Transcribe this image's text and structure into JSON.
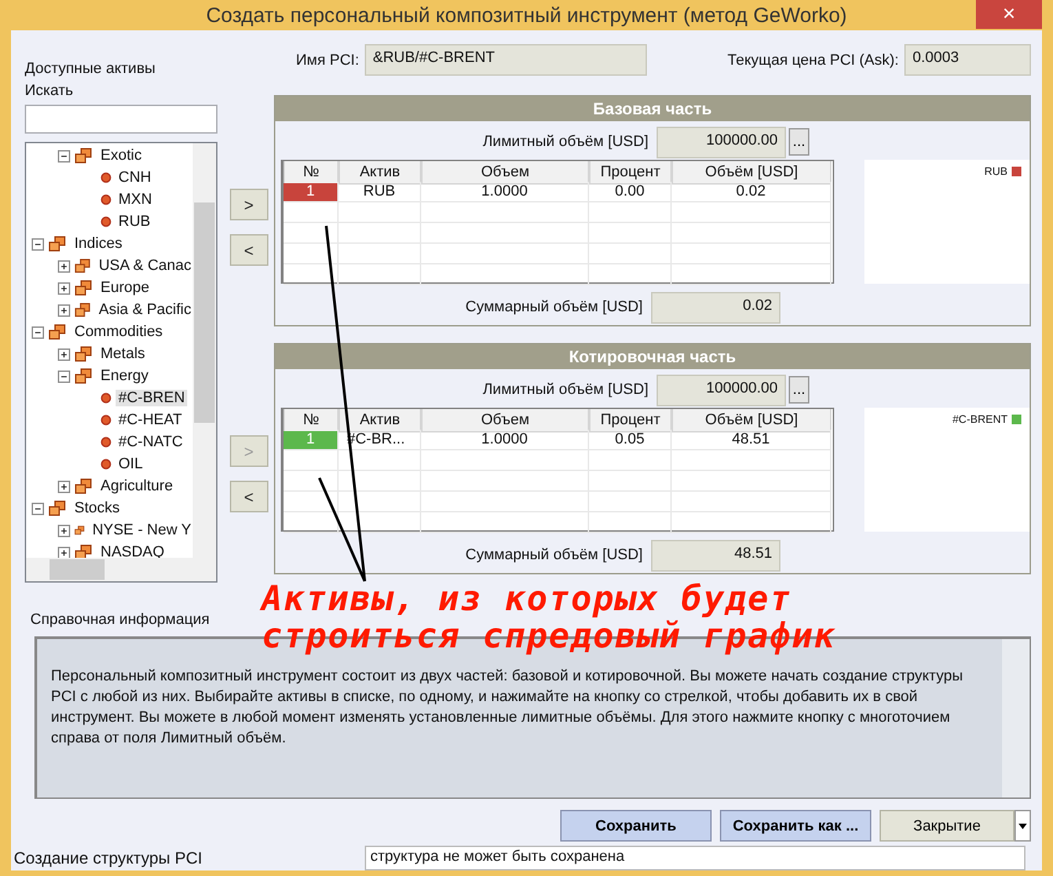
{
  "window": {
    "title": "Создать персональный композитный инструмент (метод GeWorko)",
    "close": "×"
  },
  "assets": {
    "label": "Доступные активы",
    "search_label": "Искать",
    "tree_continued": [
      {
        "label": "Exotic",
        "expanded": true,
        "selected": false,
        "children": [
          {
            "label": "CNH",
            "selected": false
          },
          {
            "label": "MXN",
            "selected": false
          },
          {
            "label": "RUB",
            "selected": false
          }
        ]
      }
    ],
    "tree": [
      {
        "label": "Indices",
        "expanded": true,
        "selected": false,
        "children": [
          {
            "label": "USA & Canac",
            "expanded": false,
            "selected": false
          },
          {
            "label": "Europe",
            "expanded": false,
            "selected": false
          },
          {
            "label": "Asia & Pacific",
            "expanded": false,
            "selected": false
          }
        ]
      },
      {
        "label": "Commodities",
        "expanded": true,
        "selected": false,
        "children": [
          {
            "label": "Metals",
            "expanded": false,
            "selected": false
          },
          {
            "label": "Energy",
            "expanded": true,
            "selected": false,
            "children": [
              {
                "label": "#C-BREN",
                "selected": true
              },
              {
                "label": "#C-HEAT",
                "selected": false
              },
              {
                "label": "#C-NATC",
                "selected": false
              },
              {
                "label": "OIL",
                "selected": false
              }
            ]
          },
          {
            "label": "Agriculture",
            "expanded": false,
            "selected": false
          }
        ]
      },
      {
        "label": "Stocks",
        "expanded": true,
        "selected": false,
        "children": [
          {
            "label": "NYSE - New Y",
            "expanded": false,
            "selected": false
          },
          {
            "label": "NASDAQ",
            "expanded": false,
            "selected": false
          }
        ]
      }
    ]
  },
  "pci_name": {
    "label": "Имя PCI:",
    "value": "&RUB/#C-BRENT"
  },
  "pci_price": {
    "label": "Текущая цена PCI (Ask):",
    "value": "0.0003"
  },
  "parts": [
    {
      "title": "Базовая часть",
      "add": ">",
      "remove": "<",
      "add_disabled": false,
      "remove_disabled": false,
      "limit_label": "Лимитный объём [USD]",
      "limit_value": "100000.00",
      "limit_button": "...",
      "columns": [
        "№",
        "Актив",
        "Объем",
        "Процент",
        "Объём [USD]"
      ],
      "rows": [
        {
          "color": "#c8443c",
          "cells": [
            "1",
            "RUB",
            "1.0000",
            "0.00",
            "0.02"
          ]
        }
      ],
      "legend": [
        {
          "label": "RUB",
          "color": "#c8443c"
        }
      ],
      "sum_label": "Суммарный объём [USD]",
      "sum_value": "0.02"
    },
    {
      "title": "Котировочная часть",
      "add": ">",
      "remove": "<",
      "add_disabled": true,
      "remove_disabled": false,
      "limit_label": "Лимитный объём [USD]",
      "limit_value": "100000.00",
      "limit_button": "...",
      "columns": [
        "№",
        "Актив",
        "Объем",
        "Процент",
        "Объём [USD]"
      ],
      "rows": [
        {
          "color": "#5cb84c",
          "cells": [
            "1",
            "#C-BR...",
            "1.0000",
            "0.05",
            "48.51"
          ]
        }
      ],
      "legend": [
        {
          "label": "#C-BRENT",
          "color": "#5cb84c"
        }
      ],
      "sum_label": "Суммарный объём [USD]",
      "sum_value": "48.51"
    }
  ],
  "annotation": {
    "lines": [
      "Активы, из которых будет",
      "строиться спредовый график"
    ]
  },
  "help": {
    "label": "Справочная информация",
    "text": "Персональный композитный инструмент состоит из двух частей: базовой и котировочной. Вы можете начать создание структуры PCI с любой из них. Выбирайте активы в списке, по одному, и нажимайте на кнопку со стрелкой, чтобы добавить их в свой инструмент. Вы можете в любой момент изменять установленные лимитные объёмы. Для этого нажмите кнопку с многоточием справа от поля Лимитный объём."
  },
  "buttons": [
    {
      "label": "Сохранить",
      "kind": "primary"
    },
    {
      "label": "Сохранить как ...",
      "kind": "primary"
    },
    {
      "label": "Закрытие",
      "kind": "split"
    }
  ],
  "status_bar": {
    "label": "Создание структуры PCI",
    "message": "структура не может быть сохранена"
  }
}
